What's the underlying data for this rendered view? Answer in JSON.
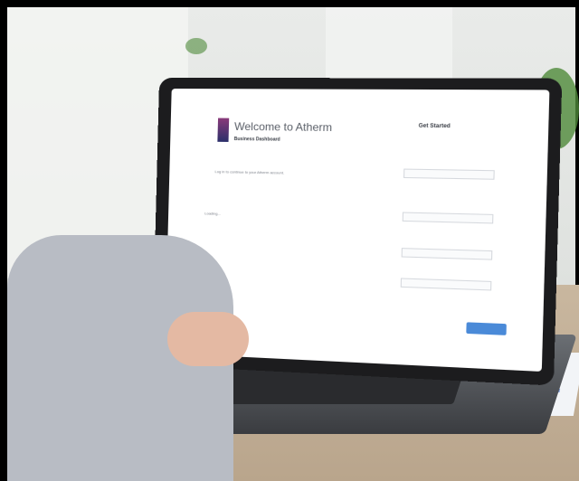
{
  "screen": {
    "welcome": "Welcome to Atherm",
    "subtitle": "Business Dashboard",
    "intro": "Log in to continue to your Atherm account.",
    "status": "Loading...",
    "panel_title": "Get Started"
  }
}
